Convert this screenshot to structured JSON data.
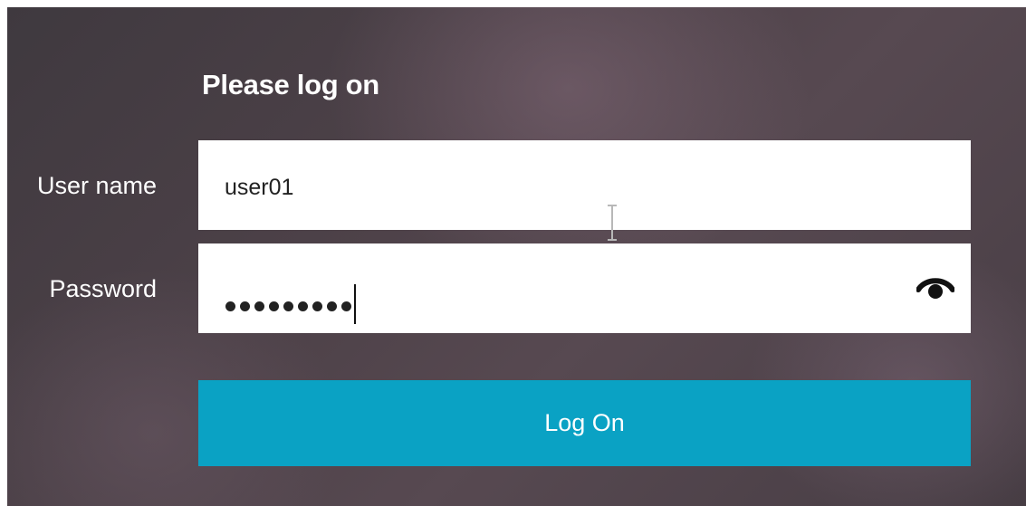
{
  "form": {
    "title": "Please log on",
    "username_label": "User name",
    "username_value": "user01",
    "password_label": "Password",
    "password_mask_length": 9,
    "show_password_icon": "eye-icon",
    "submit_label": "Log On"
  },
  "colors": {
    "background": "#4b4047",
    "button": "#0aa2c4",
    "text_light": "#ffffff"
  }
}
